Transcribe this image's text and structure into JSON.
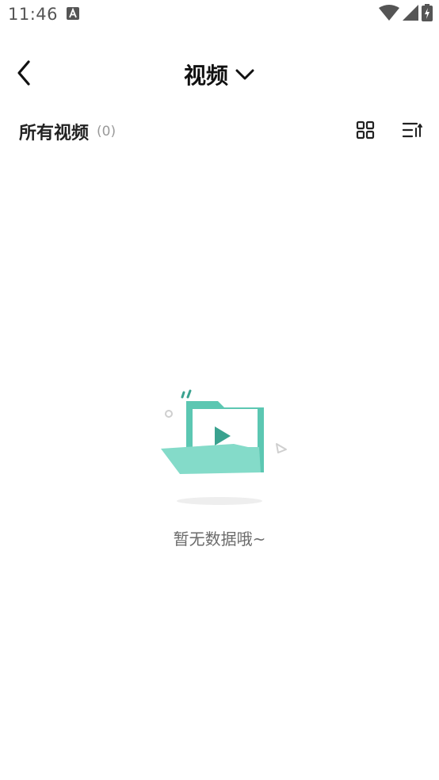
{
  "status_bar": {
    "time": "11:46",
    "icons": [
      "notification-a-icon",
      "wifi-icon",
      "cell-signal-icon",
      "battery-charging-icon"
    ]
  },
  "header": {
    "title": "视频",
    "icons": [
      "back-arrow-icon",
      "chevron-down-icon"
    ]
  },
  "section": {
    "title": "所有视频",
    "count": "(0)",
    "icons": [
      "grid-view-icon",
      "sort-icon"
    ]
  },
  "empty_state": {
    "message": "暂无数据哦~",
    "illustration": "empty-folder-video-icon"
  },
  "colors": {
    "accent": "#5cc7b2",
    "accent_light": "#84dbc9",
    "accent_dark": "#3aa28f",
    "text_primary": "#222222",
    "text_muted": "#9a9a9a"
  }
}
